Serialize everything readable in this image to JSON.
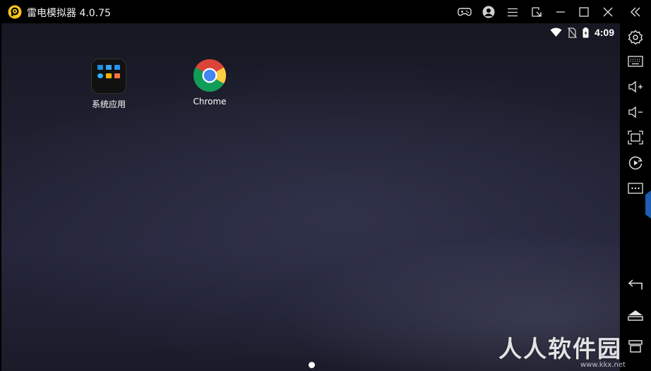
{
  "window": {
    "title": "雷电模拟器 4.0.75",
    "brand_color": "#f5c518"
  },
  "titlebar_buttons": [
    {
      "name": "gamepad-icon"
    },
    {
      "name": "account-icon"
    },
    {
      "name": "menu-icon"
    },
    {
      "name": "shrink-window-icon"
    },
    {
      "name": "minimize-icon"
    },
    {
      "name": "maximize-icon"
    },
    {
      "name": "close-icon"
    },
    {
      "name": "collapse-sidebar-icon"
    }
  ],
  "statusbar": {
    "time": "4:09",
    "icons": [
      "wifi-icon",
      "no-sim-icon",
      "battery-icon"
    ]
  },
  "desktop": {
    "apps": [
      {
        "label": "系统应用",
        "icon": "folder-icon"
      },
      {
        "label": "Chrome",
        "icon": "chrome-icon"
      }
    ],
    "page_indicator": {
      "pages": 1,
      "current": 1
    }
  },
  "sidebar": {
    "top_buttons": [
      "settings-icon",
      "keyboard-icon",
      "volume-up-icon",
      "volume-down-icon",
      "screenshot-icon",
      "record-icon",
      "more-icon"
    ],
    "bottom_buttons": [
      "back-icon",
      "home-icon",
      "recent-apps-icon"
    ]
  },
  "watermark": {
    "text": "人人软件园",
    "url": "www.kkx.net"
  }
}
